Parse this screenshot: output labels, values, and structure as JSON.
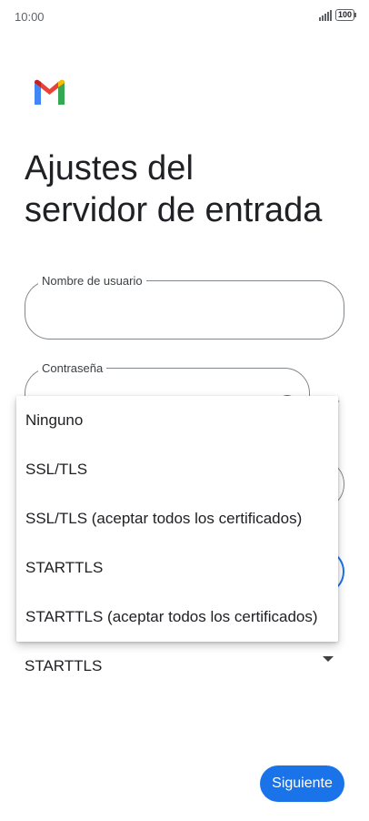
{
  "status_bar": {
    "time": "10:00",
    "battery": "100",
    "signal_icon": "signal-bars-icon"
  },
  "logo": {
    "icon": "gmail-logo",
    "colors": [
      "#4285f4",
      "#ea4335",
      "#fbbc04",
      "#34a853",
      "#c5221f"
    ]
  },
  "page": {
    "title_line1": "Ajustes del",
    "title_line2": "servidor de entrada"
  },
  "form": {
    "username": {
      "label": "Nombre de usuario",
      "value": ""
    },
    "password": {
      "label": "Contraseña",
      "value": "",
      "icon": "eye-icon"
    },
    "security": {
      "selected": "STARTTLS",
      "accent": "#1a73e8"
    }
  },
  "dropdown": {
    "options": [
      "Ninguno",
      "SSL/TLS",
      "SSL/TLS (aceptar todos los certificados)",
      "STARTTLS",
      "STARTTLS (aceptar todos los certificados)"
    ]
  },
  "actions": {
    "next_label": "Siguiente",
    "accent": "#1a73e8"
  }
}
